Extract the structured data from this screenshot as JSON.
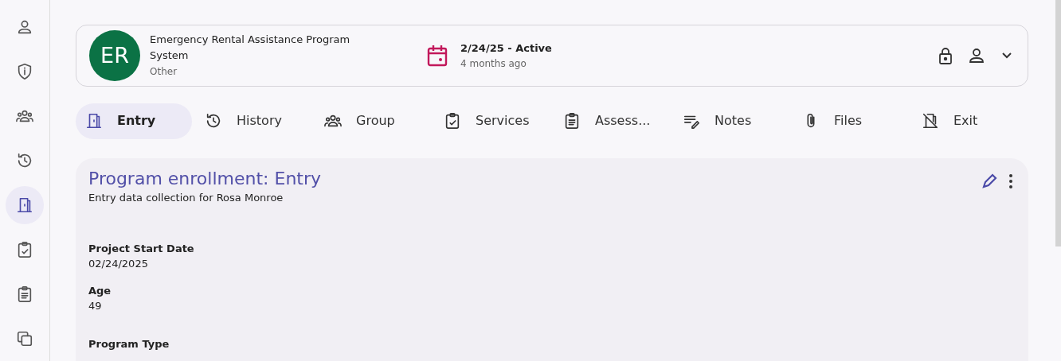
{
  "sidebar": {
    "items": [
      {
        "selected": false
      },
      {
        "selected": false
      },
      {
        "selected": false
      },
      {
        "selected": false
      },
      {
        "selected": true
      },
      {
        "selected": false
      },
      {
        "selected": false
      },
      {
        "selected": false
      }
    ]
  },
  "header": {
    "avatar": "ER",
    "program": "Emergency Rental Assistance Program System",
    "category": "Other",
    "status": "2/24/25 - Active",
    "relative_time": "4 months ago"
  },
  "tabs": [
    {
      "label": "Entry",
      "selected": true
    },
    {
      "label": "History",
      "selected": false
    },
    {
      "label": "Group",
      "selected": false
    },
    {
      "label": "Services",
      "selected": false
    },
    {
      "label": "Assess...",
      "selected": false
    },
    {
      "label": "Notes",
      "selected": false
    },
    {
      "label": "Files",
      "selected": false
    },
    {
      "label": "Exit",
      "selected": false
    }
  ],
  "panel": {
    "title": "Program enrollment: Entry",
    "subtitle": "Entry data collection for Rosa Monroe",
    "fields": [
      {
        "label": "Project Start Date",
        "value": "02/24/2025"
      },
      {
        "label": "Age",
        "value": "49"
      },
      {
        "label": "Program Type"
      }
    ]
  }
}
